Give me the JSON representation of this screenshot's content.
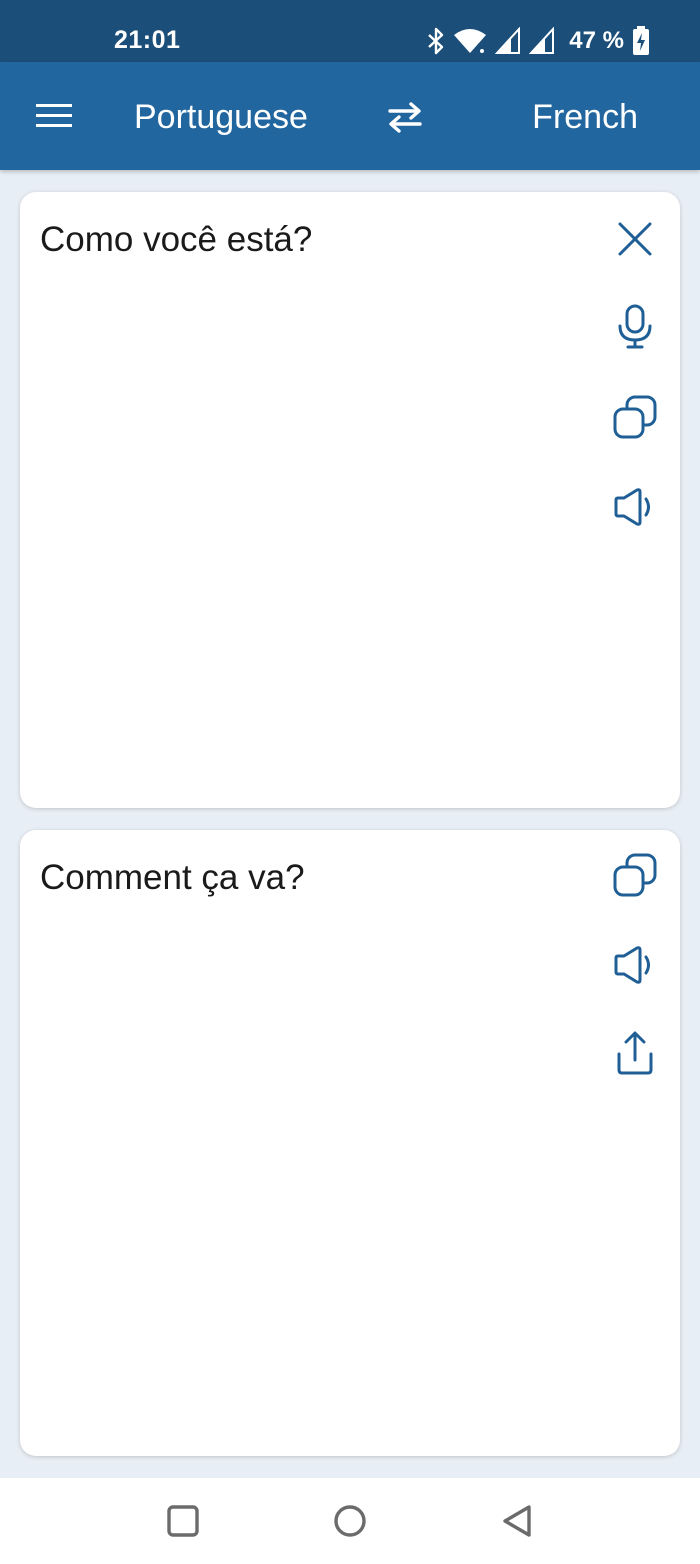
{
  "status_bar": {
    "time": "21:01",
    "battery": "47 %",
    "icons": [
      "bluetooth-icon",
      "wifi-icon",
      "signal-icon",
      "signal-icon",
      "battery-charging-icon"
    ]
  },
  "app_bar": {
    "menu_icon": "hamburger-menu-icon",
    "source_language": "Portuguese",
    "swap_icon": "swap-arrows-icon",
    "target_language": "French"
  },
  "source_card": {
    "text": "Como você está?",
    "tools": [
      "close-icon",
      "microphone-icon",
      "copy-icon",
      "speaker-icon"
    ]
  },
  "target_card": {
    "text": "Comment ça va?",
    "tools": [
      "copy-icon",
      "speaker-icon",
      "share-icon"
    ]
  },
  "nav_bar": {
    "buttons": [
      "recents-square-icon",
      "home-circle-icon",
      "back-triangle-icon"
    ]
  },
  "colors": {
    "status_bar": "#1b4f7a",
    "app_bar": "#22669f",
    "accent_icon": "#1f5f96",
    "background": "#e8eef5"
  }
}
